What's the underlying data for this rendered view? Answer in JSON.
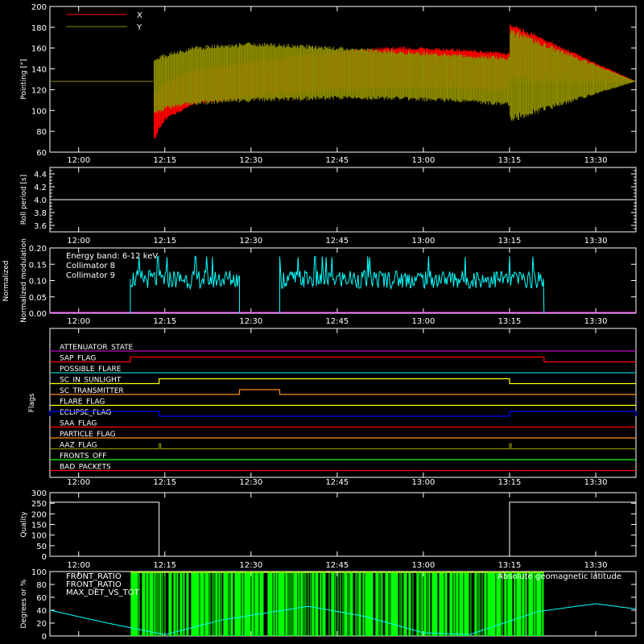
{
  "colors": {
    "background": "#000000",
    "axes": "#ffffff",
    "red": "#ff0000",
    "olive": "#8b8b00",
    "cyan": "#00ffff",
    "magenta": "#ff00ff",
    "green": "#00ff00",
    "yellow": "#ffff00",
    "orange": "#ff8c1a",
    "blue": "#0000ff",
    "purple": "#c000c0"
  },
  "time_ticks": [
    "12:00",
    "12:15",
    "12:30",
    "12:45",
    "13:00",
    "13:15",
    "13:30"
  ],
  "chart_data": [
    {
      "id": "pointing",
      "type": "line",
      "ylabel": "Pointing [\"]",
      "ylim": [
        60,
        200
      ],
      "yticks": [
        "60",
        "80",
        "100",
        "120",
        "140",
        "160",
        "180",
        "200"
      ],
      "legend": [
        {
          "name": "X",
          "color": "#ff0000"
        },
        {
          "name": "Y",
          "color": "#8b8b00"
        }
      ],
      "series": [
        {
          "name": "X",
          "color": "#ff0000",
          "x": [
            "11:55",
            "12:13",
            "12:13",
            "12:15",
            "12:20",
            "12:30",
            "12:45",
            "12:55",
            "13:05",
            "13:15",
            "13:15",
            "13:37"
          ],
          "upper": [
            128,
            128,
            118,
            128,
            140,
            148,
            158,
            162,
            160,
            156,
            185,
            128
          ],
          "lower": [
            128,
            128,
            70,
            90,
            105,
            112,
            118,
            120,
            120,
            118,
            128,
            128
          ]
        },
        {
          "name": "Y",
          "color": "#8b8b00",
          "x": [
            "11:55",
            "12:13",
            "12:13",
            "12:15",
            "12:20",
            "12:30",
            "12:45",
            "12:55",
            "13:05",
            "13:15",
            "13:15",
            "13:37"
          ],
          "upper": [
            128,
            128,
            150,
            155,
            162,
            166,
            162,
            158,
            155,
            152,
            180,
            128
          ],
          "lower": [
            128,
            128,
            95,
            100,
            105,
            108,
            110,
            110,
            108,
            104,
            88,
            128
          ]
        }
      ]
    },
    {
      "id": "roll",
      "type": "line",
      "ylabel": "Roll period [s]",
      "ylim": [
        3.5,
        4.5
      ],
      "yticks": [
        "3.6",
        "3.8",
        "4.0",
        "4.2",
        "4.4"
      ],
      "series": [
        {
          "name": "roll",
          "x": [
            "11:55",
            "13:37"
          ],
          "values": [
            4.0,
            4.0
          ]
        }
      ]
    },
    {
      "id": "modulation",
      "type": "line",
      "ylabel": "Normalized modulation",
      "ylim": [
        0,
        0.2
      ],
      "yticks": [
        "0.00",
        "0.05",
        "0.10",
        "0.15",
        "0.20"
      ],
      "legend": [
        {
          "name": "Energy band: 6-12 keV",
          "color": "#ffffff"
        },
        {
          "name": "Collimator 8",
          "color": "#00ffff"
        },
        {
          "name": "Collimator 9",
          "color": "#ff00ff"
        }
      ],
      "segments": [
        {
          "series": "Collimator 8",
          "start": "12:09",
          "end": "12:28",
          "mean": 0.105
        },
        {
          "series": "Collimator 8",
          "start": "12:35",
          "end": "13:21",
          "mean": 0.105
        }
      ]
    },
    {
      "id": "flags",
      "type": "step",
      "ylabel": "Flags",
      "flags": [
        {
          "name": "ATTENUATOR_STATE",
          "color": "#c000c0",
          "steps": []
        },
        {
          "name": "SAP_FLAG",
          "color": "#ff0000",
          "steps": [
            [
              "12:09",
              "13:21"
            ]
          ]
        },
        {
          "name": "POSSIBLE_FLARE",
          "color": "#00c8c8",
          "steps": []
        },
        {
          "name": "SC_IN_SUNLIGHT",
          "color": "#ffff00",
          "steps": [
            [
              "12:14",
              "13:15"
            ]
          ]
        },
        {
          "name": "SC_TRANSMITTER",
          "color": "#ff8c1a",
          "steps": [
            [
              "12:28",
              "12:35"
            ]
          ]
        },
        {
          "name": "FLARE_FLAG",
          "color": "#ffff00",
          "steps": []
        },
        {
          "name": "ECLIPSE_FLAG",
          "color": "#0000ff",
          "steps": [
            [
              "11:55",
              "12:14"
            ],
            [
              "13:15",
              "13:37"
            ]
          ]
        },
        {
          "name": "SAA_FLAG",
          "color": "#ff0000",
          "steps": []
        },
        {
          "name": "PARTICLE_FLAG",
          "color": "#ff8c1a",
          "steps": []
        },
        {
          "name": "AAZ_FLAG",
          "color": "#8b8b00",
          "steps": [
            [
              "12:14",
              "12:14"
            ],
            [
              "13:15",
              "13:15"
            ]
          ]
        },
        {
          "name": "FRONTS_OFF",
          "color": "#00ff00",
          "steps": []
        },
        {
          "name": "BAD_PACKETS",
          "color": "#ff0000",
          "steps": []
        }
      ]
    },
    {
      "id": "quality",
      "type": "line",
      "ylabel": "Quality",
      "ylim": [
        0,
        300
      ],
      "yticks": [
        "0",
        "50",
        "100",
        "150",
        "200",
        "250",
        "300"
      ],
      "series": [
        {
          "name": "Quality",
          "x": [
            "11:55",
            "12:14",
            "12:14",
            "13:15",
            "13:15",
            "13:37"
          ],
          "values": [
            255,
            255,
            0,
            0,
            255,
            255
          ]
        }
      ]
    },
    {
      "id": "geomag",
      "type": "area",
      "ylabel": "Degrees or %",
      "ylim": [
        0,
        100
      ],
      "yticks": [
        "0",
        "20",
        "40",
        "60",
        "80",
        "100"
      ],
      "legend": [
        {
          "name": "FRONT_RATIO",
          "color": "#ffff00"
        },
        {
          "name": "FRONT_RATIO",
          "color": "#00ff00"
        },
        {
          "name": "MAX_DET_VS_TOT",
          "color": "#ff8c1a"
        },
        {
          "name": "Absolute geomagnetic latitude",
          "color": "#00ffff"
        }
      ],
      "fill": {
        "series": "FRONT_RATIO",
        "start": "12:09",
        "end": "13:21",
        "value": 100
      },
      "latitude": {
        "x": [
          "11:55",
          "12:05",
          "12:15",
          "12:25",
          "12:40",
          "12:50",
          "13:00",
          "13:08",
          "13:20",
          "13:30",
          "13:37"
        ],
        "values": [
          40,
          20,
          2,
          25,
          46,
          30,
          5,
          2,
          38,
          50,
          42
        ]
      }
    }
  ]
}
